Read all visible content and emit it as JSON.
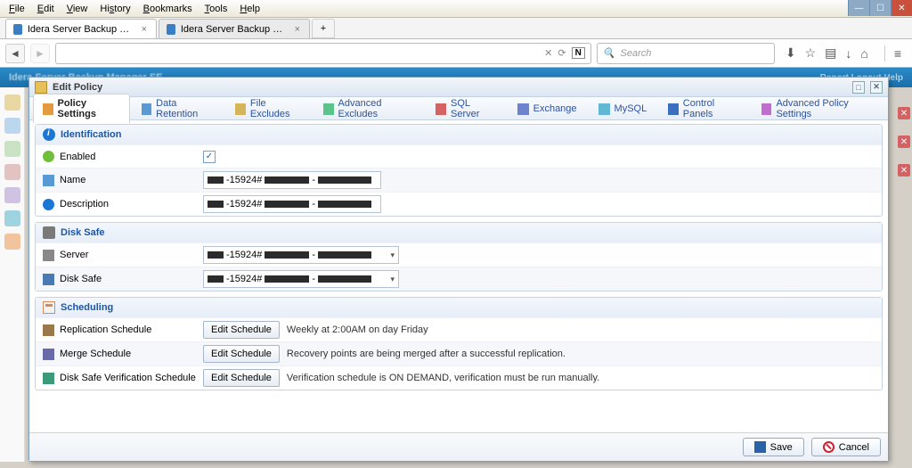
{
  "browser": {
    "menu": [
      "File",
      "Edit",
      "View",
      "History",
      "Bookmarks",
      "Tools",
      "Help"
    ],
    "tabs": [
      {
        "label": "Idera Server Backup Manag...",
        "active": true
      },
      {
        "label": "Idera Server Backup Manag...",
        "active": false
      }
    ],
    "search_placeholder": "Search"
  },
  "app_banner": "Idera Server Backup Manager SE",
  "banner_right": "Report    Logout    Help",
  "dialog": {
    "title": "Edit Policy",
    "tabs": [
      "Policy Settings",
      "Data Retention",
      "File Excludes",
      "Advanced Excludes",
      "SQL Server",
      "Exchange",
      "MySQL",
      "Control Panels",
      "Advanced Policy Settings"
    ],
    "sections": {
      "identification": {
        "title": "Identification",
        "enabled_label": "Enabled",
        "enabled_checked": true,
        "name_label": "Name",
        "name_value": "-15924#",
        "description_label": "Description",
        "description_value": "-15924#"
      },
      "disksafe": {
        "title": "Disk Safe",
        "server_label": "Server",
        "server_value": "-15924#",
        "disksafe_label": "Disk Safe",
        "disksafe_value": "-15924#"
      },
      "scheduling": {
        "title": "Scheduling",
        "edit_btn": "Edit Schedule",
        "replication_label": "Replication Schedule",
        "replication_desc": "Weekly at 2:00AM on day Friday",
        "merge_label": "Merge Schedule",
        "merge_desc": "Recovery points are being merged after a successful replication.",
        "verify_label": "Disk Safe Verification Schedule",
        "verify_desc": "Verification schedule is ON DEMAND, verification must be run manually."
      }
    },
    "footer": {
      "save": "Save",
      "cancel": "Cancel"
    }
  }
}
